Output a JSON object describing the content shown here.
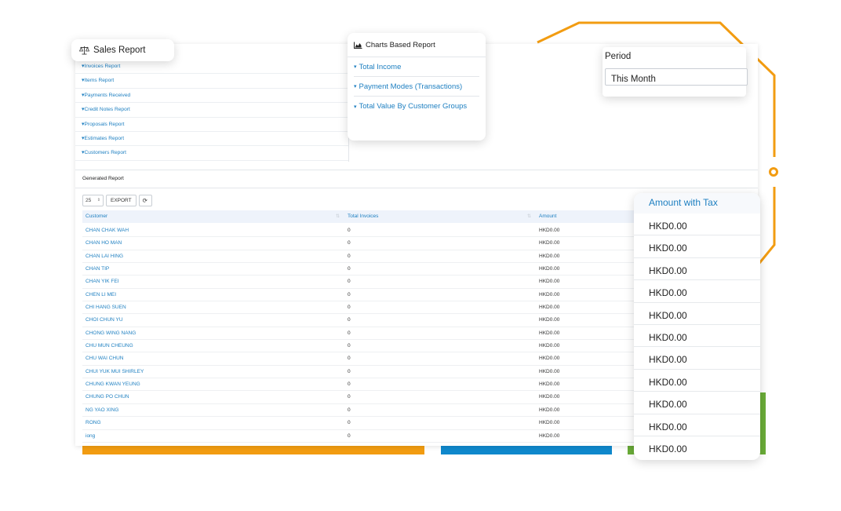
{
  "sales_report": {
    "title": "Sales Report"
  },
  "reports": [
    {
      "label": "Invoices Report"
    },
    {
      "label": "Items Report"
    },
    {
      "label": "Payments Received"
    },
    {
      "label": "Credit Notes Report"
    },
    {
      "label": "Proposals Report"
    },
    {
      "label": "Estimates Report"
    },
    {
      "label": "Customers Report"
    }
  ],
  "charts": {
    "title": "Charts Based Report",
    "items": [
      {
        "label": "Total Income"
      },
      {
        "label": "Payment Modes (Transactions)"
      },
      {
        "label": "Total Value By Customer Groups"
      }
    ]
  },
  "period": {
    "label": "Period",
    "value": "This Month"
  },
  "generated": {
    "title": "Generated Report",
    "page_size": "25",
    "export_label": "EXPORT",
    "columns": {
      "customer": "Customer",
      "total_invoices": "Total Invoices",
      "amount": "Amount"
    },
    "rows": [
      {
        "customer": "CHAN CHAK WAH",
        "total_invoices": "0",
        "amount": "HKD0.00"
      },
      {
        "customer": "CHAN HO MAN",
        "total_invoices": "0",
        "amount": "HKD0.00"
      },
      {
        "customer": "CHAN LAI HING",
        "total_invoices": "0",
        "amount": "HKD0.00"
      },
      {
        "customer": "CHAN TIP",
        "total_invoices": "0",
        "amount": "HKD0.00"
      },
      {
        "customer": "CHAN YIK FEI",
        "total_invoices": "0",
        "amount": "HKD0.00"
      },
      {
        "customer": "CHEN LI MEI",
        "total_invoices": "0",
        "amount": "HKD0.00"
      },
      {
        "customer": "CHI HANG SUEN",
        "total_invoices": "0",
        "amount": "HKD0.00"
      },
      {
        "customer": "CHOI CHUN YU",
        "total_invoices": "0",
        "amount": "HKD0.00"
      },
      {
        "customer": "CHONG WING NANG",
        "total_invoices": "0",
        "amount": "HKD0.00"
      },
      {
        "customer": "CHU MUN CHEUNG",
        "total_invoices": "0",
        "amount": "HKD0.00"
      },
      {
        "customer": "CHU WAI CHUN",
        "total_invoices": "0",
        "amount": "HKD0.00"
      },
      {
        "customer": "CHUI YUK MUI SHIRLEY",
        "total_invoices": "0",
        "amount": "HKD0.00"
      },
      {
        "customer": "CHUNG KWAN YEUNG",
        "total_invoices": "0",
        "amount": "HKD0.00"
      },
      {
        "customer": "CHUNG PO CHUN",
        "total_invoices": "0",
        "amount": "HKD0.00"
      },
      {
        "customer": "NG YAO XING",
        "total_invoices": "0",
        "amount": "HKD0.00"
      },
      {
        "customer": "RONG",
        "total_invoices": "0",
        "amount": "HKD0.00"
      },
      {
        "customer": "iong",
        "total_invoices": "0",
        "amount": "HKD0.00"
      }
    ]
  },
  "amount_with_tax": {
    "header": "Amount with Tax",
    "values": [
      "HKD0.00",
      "HKD0.00",
      "HKD0.00",
      "HKD0.00",
      "HKD0.00",
      "HKD0.00",
      "HKD0.00",
      "HKD0.00",
      "HKD0.00",
      "HKD0.00",
      "HKD0.00"
    ]
  },
  "colors": {
    "accent": "#1d7fc1",
    "orange": "#f29c11",
    "blue": "#0f88cc",
    "green": "#6aad38"
  }
}
